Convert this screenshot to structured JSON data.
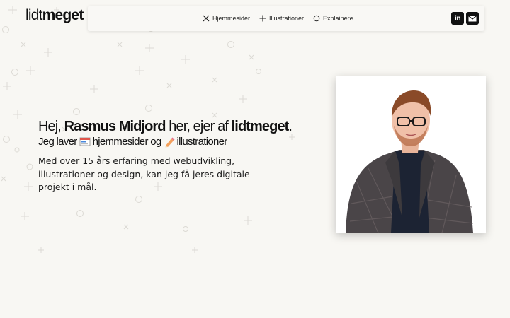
{
  "logo": {
    "part1": "lidt",
    "part2": "meget"
  },
  "nav": {
    "items": [
      {
        "label": "Hjemmesider",
        "icon": "cross-icon"
      },
      {
        "label": "Illustrationer",
        "icon": "plus-icon"
      },
      {
        "label": "Explainere",
        "icon": "circle-icon"
      }
    ]
  },
  "social": {
    "linkedin_text": "in",
    "linkedin_icon": "linkedin-icon",
    "mail_icon": "mail-icon"
  },
  "hero": {
    "title_pre": "Hej, ",
    "name": "Rasmus Midjord",
    "title_mid": " her, ejer af ",
    "brand": "lidtmeget",
    "title_end": ".",
    "sub_pre": "Jeg laver",
    "sub_mid": "hjemmesider og",
    "sub_end": "illustrationer",
    "description": "Med over 15 års erfaring med webudvikling, illustrationer og design, kan jeg få jeres digitale projekt i mål."
  },
  "colors": {
    "background": "#f8f7f3",
    "text": "#111111",
    "jacket": "#4a4548",
    "shirt": "#1c2333"
  }
}
